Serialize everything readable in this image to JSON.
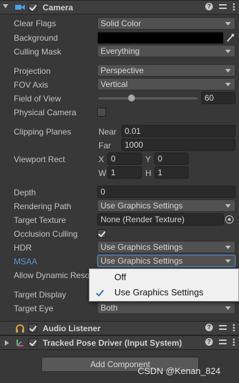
{
  "camera": {
    "title": "Camera",
    "enabled": true,
    "clear_flags": {
      "label": "Clear Flags",
      "value": "Solid Color"
    },
    "background": {
      "label": "Background",
      "color": "#000000"
    },
    "culling_mask": {
      "label": "Culling Mask",
      "value": "Everything"
    },
    "projection": {
      "label": "Projection",
      "value": "Perspective"
    },
    "fov_axis": {
      "label": "FOV Axis",
      "value": "Vertical"
    },
    "field_of_view": {
      "label": "Field of View",
      "value": "60",
      "slider_fraction": 0.3
    },
    "physical_camera": {
      "label": "Physical Camera",
      "checked": false
    },
    "clipping_planes": {
      "label": "Clipping Planes",
      "near_label": "Near",
      "near_value": "0.01",
      "far_label": "Far",
      "far_value": "1000"
    },
    "viewport_rect": {
      "label": "Viewport Rect",
      "x_label": "X",
      "x": "0",
      "y_label": "Y",
      "y": "0",
      "w_label": "W",
      "w": "1",
      "h_label": "H",
      "h": "1"
    },
    "depth": {
      "label": "Depth",
      "value": "0"
    },
    "rendering_path": {
      "label": "Rendering Path",
      "value": "Use Graphics Settings"
    },
    "target_texture": {
      "label": "Target Texture",
      "value": "None (Render Texture)"
    },
    "occlusion_culling": {
      "label": "Occlusion Culling",
      "checked": true
    },
    "hdr": {
      "label": "HDR",
      "value": "Use Graphics Settings"
    },
    "msaa": {
      "label": "MSAA",
      "value": "Use Graphics Settings",
      "label_color": "#5c94d6"
    },
    "allow_dynamic_resolution": {
      "label": "Allow Dynamic Reso"
    },
    "target_display": {
      "label": "Target Display"
    },
    "target_eye": {
      "label": "Target Eye",
      "value": "Both"
    }
  },
  "msaa_popup": {
    "options": [
      {
        "label": "Off",
        "selected": false
      },
      {
        "label": "Use Graphics Settings",
        "selected": true
      }
    ]
  },
  "audio_listener": {
    "title": "Audio Listener",
    "enabled": true
  },
  "tracked_pose_driver": {
    "title": "Tracked Pose Driver (Input System)",
    "enabled": true
  },
  "add_component": {
    "label": "Add Component"
  },
  "watermark": {
    "text": "CSDN @Kenan_824"
  },
  "icons": [
    "camera-icon",
    "headphones-icon",
    "transform-axes-icon",
    "help-icon",
    "presets-icon",
    "more-icon",
    "color-picker-icon",
    "object-picker-icon"
  ]
}
